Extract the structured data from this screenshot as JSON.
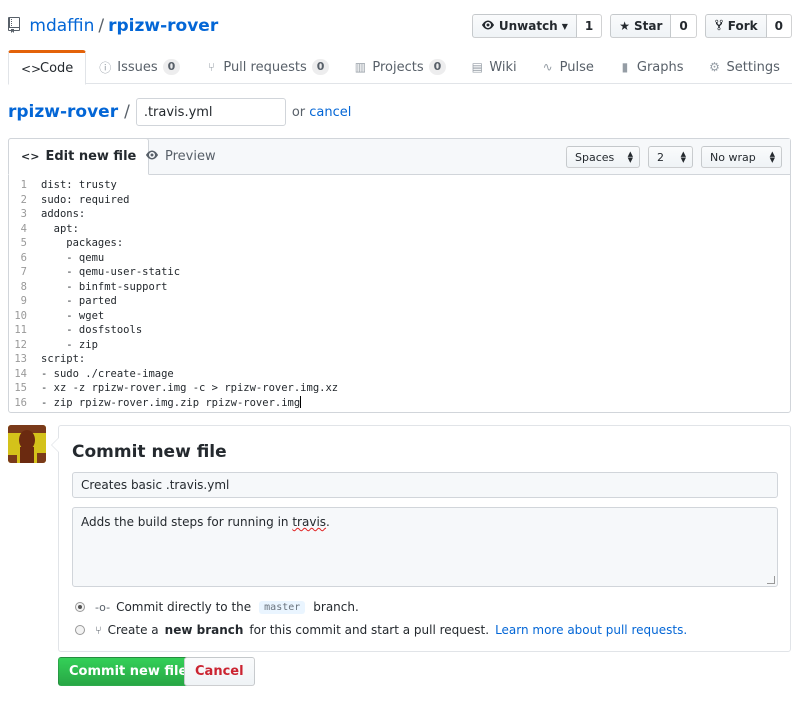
{
  "repo": {
    "owner": "mdaffin",
    "separator": "/",
    "name": "rpizw-rover"
  },
  "actions": {
    "watch_label": "Unwatch",
    "watch_count": "1",
    "star_label": "Star",
    "star_count": "0",
    "fork_label": "Fork",
    "fork_count": "0"
  },
  "tabs": [
    {
      "label": "Code",
      "counter": ""
    },
    {
      "label": "Issues",
      "counter": "0"
    },
    {
      "label": "Pull requests",
      "counter": "0"
    },
    {
      "label": "Projects",
      "counter": "0"
    },
    {
      "label": "Wiki",
      "counter": ""
    },
    {
      "label": "Pulse",
      "counter": ""
    },
    {
      "label": "Graphs",
      "counter": ""
    },
    {
      "label": "Settings",
      "counter": ""
    }
  ],
  "breadcrumb": {
    "repo": "rpizw-rover",
    "slash": "/",
    "filename": ".travis.yml",
    "or_text": "or",
    "cancel_link": "cancel"
  },
  "editor": {
    "edit_tab": "Edit new file",
    "preview_tab": "Preview",
    "indent_mode": "Spaces",
    "indent_size": "2",
    "wrap_mode": "No wrap",
    "lines": [
      "dist: trusty",
      "sudo: required",
      "addons:",
      "  apt:",
      "    packages:",
      "    - qemu",
      "    - qemu-user-static",
      "    - binfmt-support",
      "    - parted",
      "    - wget",
      "    - dosfstools",
      "    - zip",
      "script:",
      "- sudo ./create-image",
      "- xz -z rpizw-rover.img -c > rpizw-rover.img.xz",
      "- zip rpizw-rover.img.zip rpizw-rover.img"
    ]
  },
  "commit": {
    "title": "Commit new file",
    "summary_value": "Creates basic .travis.yml",
    "description_before": "Adds the build steps for running in ",
    "description_misspelled": "travis",
    "description_after": ".",
    "option_direct_prefix": "Commit directly to the",
    "option_direct_branch": "master",
    "option_direct_suffix": "branch.",
    "option_branch_prefix": "Create a",
    "option_branch_bold": "new branch",
    "option_branch_suffix": "for this commit and start a pull request.",
    "option_branch_link": "Learn more about pull requests.",
    "submit_label": "Commit new file",
    "cancel_label": "Cancel"
  },
  "colors": {
    "link": "#0366d6",
    "primary_button": "#28a745",
    "cancel_text": "#cb2431",
    "selected_tab_accent": "#e36209"
  }
}
